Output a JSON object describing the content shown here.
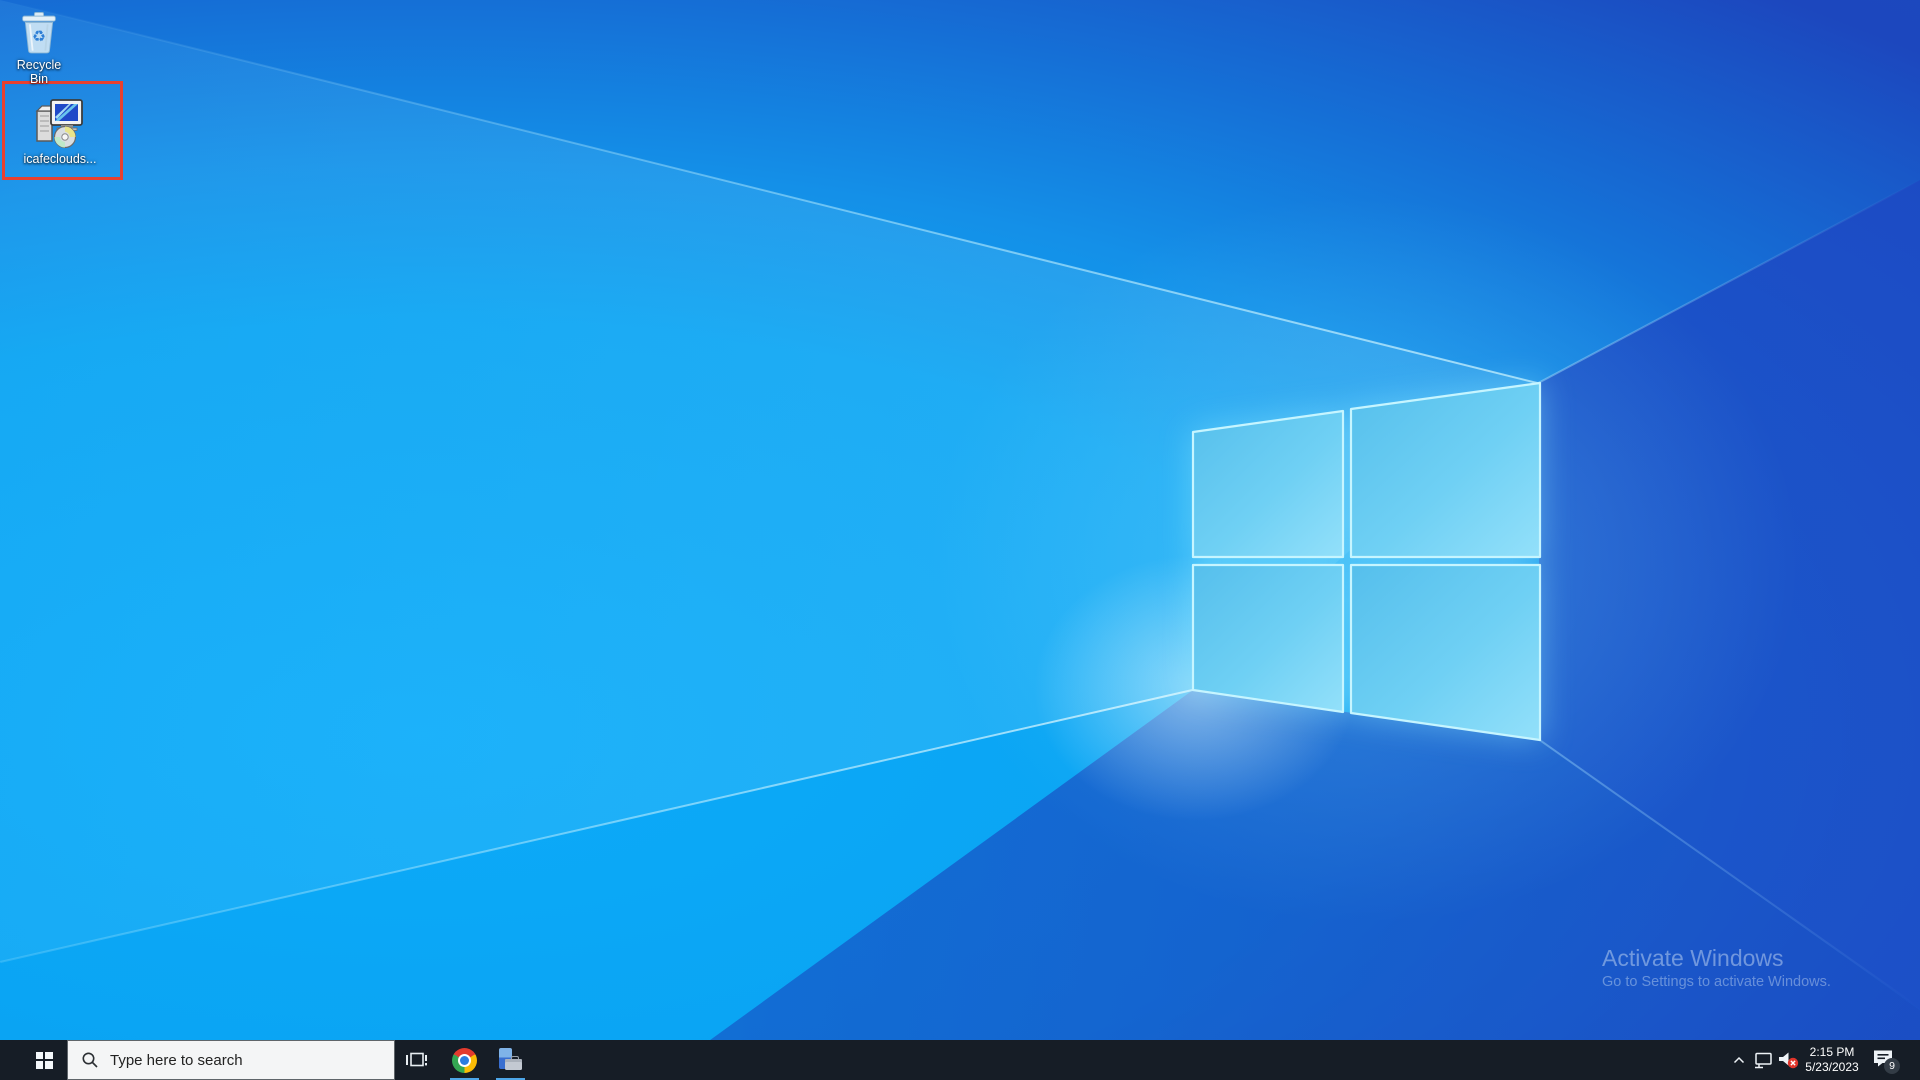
{
  "desktop": {
    "icons": [
      {
        "label": "Recycle Bin",
        "icon": "recycle-bin-icon"
      },
      {
        "label": "icafeclouds...",
        "icon": "installer-icon"
      }
    ],
    "highlight_box_color": "#e8402f",
    "watermark": {
      "line1": "Activate Windows",
      "line2": "Go to Settings to activate Windows."
    }
  },
  "taskbar": {
    "search_placeholder": "Type here to search",
    "buttons": [
      {
        "name": "start",
        "icon": "windows-logo-icon"
      },
      {
        "name": "task-view",
        "icon": "task-view-icon"
      },
      {
        "name": "chrome",
        "icon": "chrome-icon",
        "running": true
      },
      {
        "name": "installer",
        "icon": "installer-app-icon",
        "running": true
      }
    ],
    "tray": [
      {
        "icon": "chevron-up-icon"
      },
      {
        "icon": "network-icon"
      },
      {
        "icon": "volume-muted-icon"
      },
      {
        "icon": "action-center-icon",
        "badge": "9"
      }
    ],
    "clock": {
      "time": "2:15 PM",
      "date": "5/23/2023"
    }
  },
  "colors": {
    "taskbar_bg": "#161d26",
    "wallpaper_azure": "#00a9f7",
    "wallpaper_royal": "#1c47be",
    "running_underline": "#4da6e8",
    "highlight_box": "#e8402f"
  }
}
